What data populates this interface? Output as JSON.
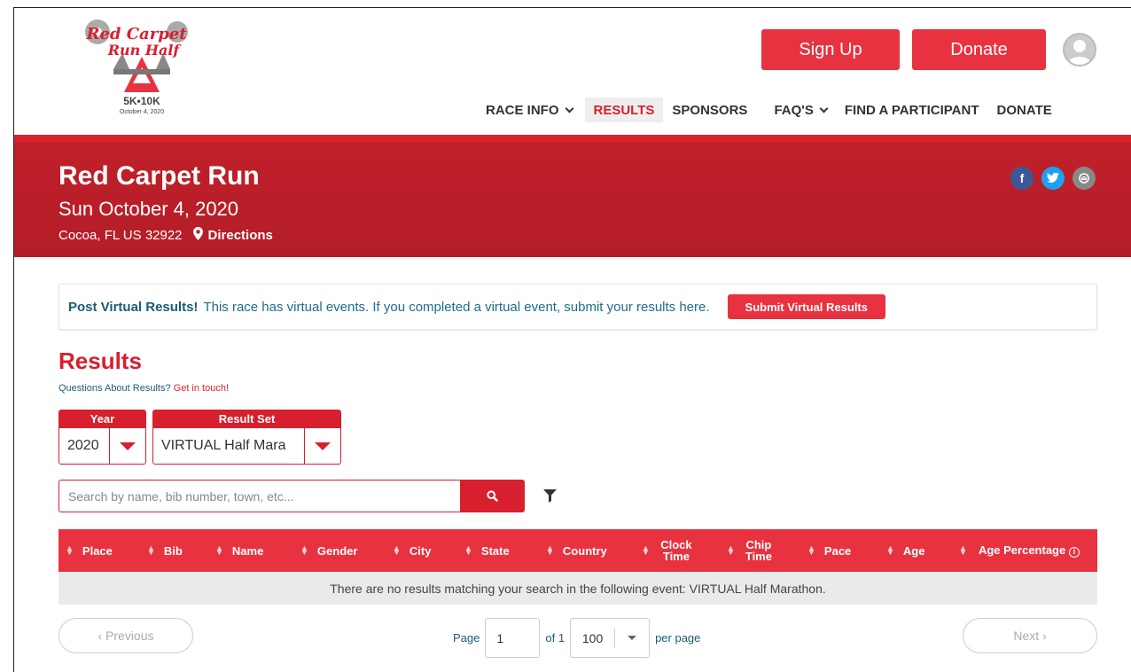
{
  "header": {
    "logo_lines": [
      "Red Carpet",
      "Run Half",
      "5K•10K",
      "October 4, 2020"
    ],
    "signup_label": "Sign Up",
    "donate_label": "Donate",
    "nav": [
      {
        "label": "RACE INFO",
        "dropdown": true,
        "active": false
      },
      {
        "label": "RESULTS",
        "dropdown": false,
        "active": true
      },
      {
        "label": "SPONSORS",
        "dropdown": false,
        "active": false
      },
      {
        "label": "FAQ'S",
        "dropdown": true,
        "active": false
      },
      {
        "label": "FIND A PARTICIPANT",
        "dropdown": false,
        "active": false
      },
      {
        "label": "DONATE",
        "dropdown": false,
        "active": false
      }
    ]
  },
  "banner": {
    "title": "Red Carpet Run",
    "date": "Sun October 4, 2020",
    "location": "Cocoa, FL US 32922",
    "directions_label": "Directions",
    "social": [
      "facebook-icon",
      "twitter-icon",
      "email-icon"
    ]
  },
  "notice": {
    "bold": "Post Virtual Results!",
    "text": "This race has virtual events. If you completed a virtual event, submit your results here.",
    "button": "Submit Virtual Results"
  },
  "results": {
    "title": "Results",
    "question": "Questions About Results?",
    "contact_link": "Get in touch!",
    "year_label": "Year",
    "year_value": "2020",
    "set_label": "Result Set",
    "set_value": "VIRTUAL Half Mara",
    "search_placeholder": "Search by name, bib number, town, etc...",
    "columns": [
      "Place",
      "Bib",
      "Name",
      "Gender",
      "City",
      "State",
      "Country",
      "Clock Time",
      "Chip Time",
      "Pace",
      "Age",
      "Age Percentage"
    ],
    "empty_message": "There are no results matching your search in the following event: VIRTUAL Half Marathon."
  },
  "pagination": {
    "previous": "‹ Previous",
    "next": "Next ›",
    "page_label": "Page",
    "page_value": "1",
    "of_label": "of 1",
    "per_page_value": "100",
    "per_page_label": "per page"
  },
  "colors": {
    "brand_red": "#e8323f",
    "banner_red": "#b41d27",
    "link_blue": "#1a5c78"
  }
}
